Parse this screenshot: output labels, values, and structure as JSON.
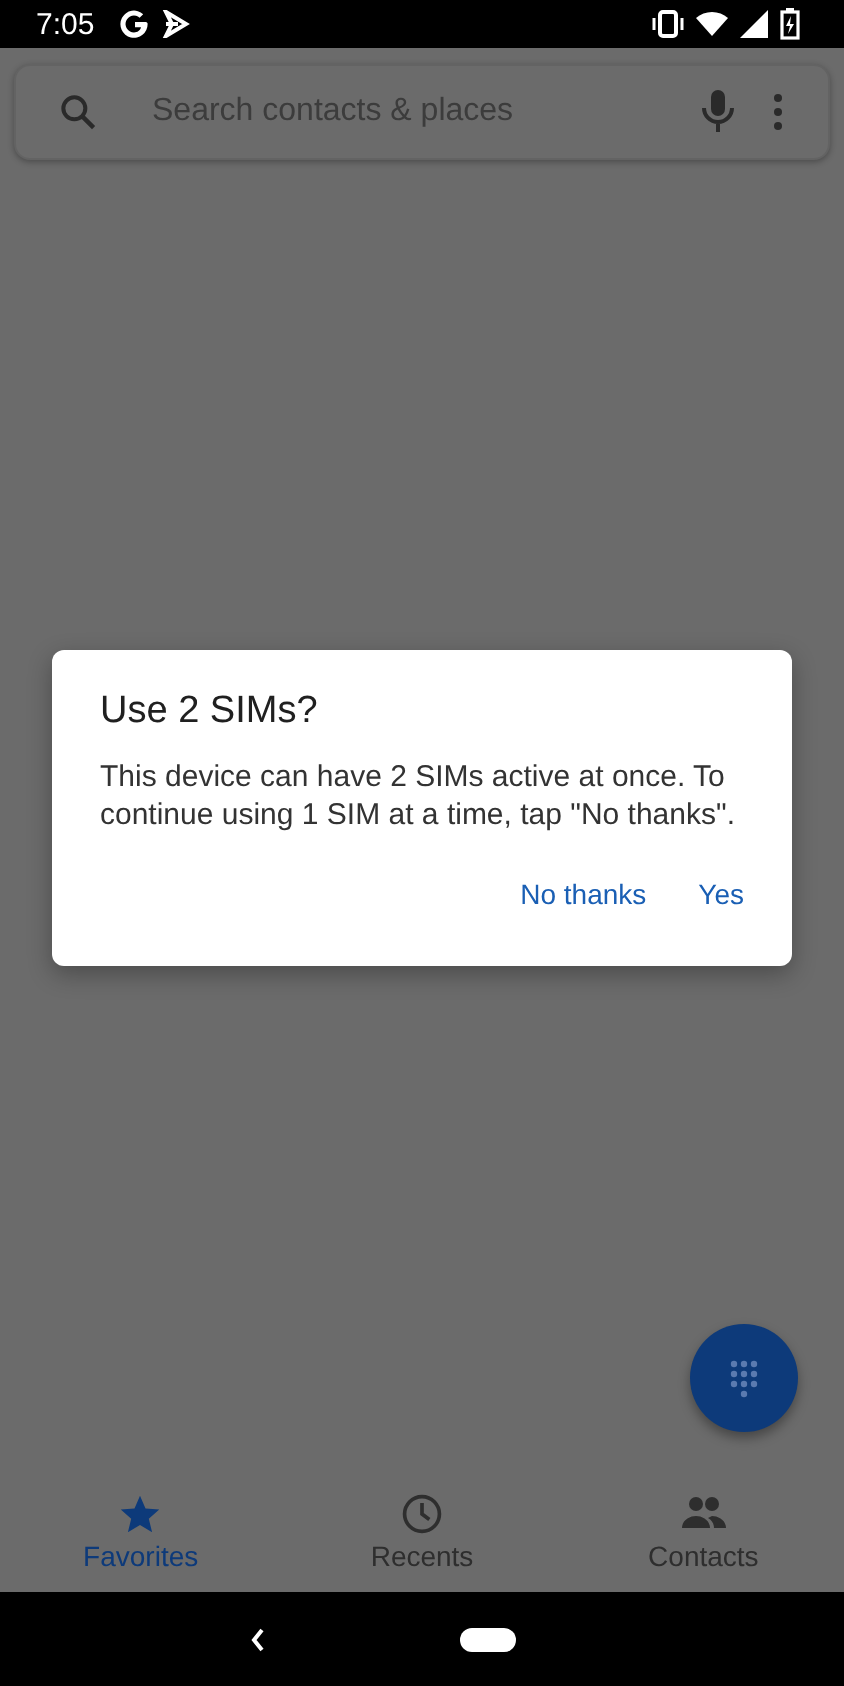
{
  "status_bar": {
    "time": "7:05"
  },
  "search": {
    "placeholder": "Search contacts & places"
  },
  "dialog": {
    "title": "Use 2 SIMs?",
    "message": "This device can have 2 SIMs active at once. To continue using 1 SIM at a time, tap \"No thanks\".",
    "buttons": [
      "No thanks",
      "Yes"
    ]
  },
  "tabs": [
    {
      "label": "Favorites",
      "kind": "star",
      "selected": true
    },
    {
      "label": "Recents",
      "kind": "clock",
      "selected": false
    },
    {
      "label": "Contacts",
      "kind": "people",
      "selected": false
    }
  ]
}
